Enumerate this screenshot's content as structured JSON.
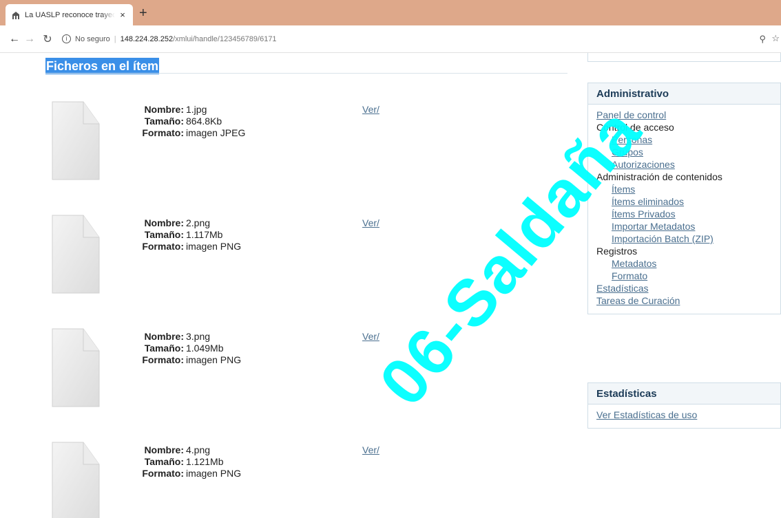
{
  "browser": {
    "tab_title": "La UASLP reconoce trayectoria a",
    "tab_close": "×",
    "new_tab": "+",
    "security_label": "No seguro",
    "url_host": "148.224.28.252",
    "url_path": "/xmlui/handle/123456789/6171"
  },
  "main": {
    "section_title": "Ficheros en el ítem",
    "labels": {
      "name": "Nombre:",
      "size": "Tamaño:",
      "format": "Formato:"
    },
    "view_label": "Ver/",
    "files": [
      {
        "name": "1.jpg",
        "size": "864.8Kb",
        "format": "imagen JPEG"
      },
      {
        "name": "2.png",
        "size": "1.117Mb",
        "format": "imagen PNG"
      },
      {
        "name": "3.png",
        "size": "1.049Mb",
        "format": "imagen PNG"
      },
      {
        "name": "4.png",
        "size": "1.121Mb",
        "format": "imagen PNG"
      }
    ]
  },
  "sidebar": {
    "admin": {
      "title": "Administrativo",
      "control_panel": "Panel de control",
      "access_control": "Control de acceso",
      "people": "Personas",
      "groups": "Grupos",
      "authorizations": "Autorizaciones",
      "content_admin": "Administración de contenidos",
      "items": "Ítems",
      "deleted_items": "Ítems eliminados",
      "private_items": "Ítems Privados",
      "import_metadata": "Importar Metadatos",
      "batch_import": "Importación Batch (ZIP)",
      "registries": "Registros",
      "metadata": "Metadatos",
      "format": "Formato",
      "statistics": "Estadísticas",
      "curation_tasks": "Tareas de Curación"
    },
    "stats": {
      "title": "Estadísticas",
      "view_usage": "Ver Estadísticas de uso"
    }
  },
  "watermark": "06-Saldaña"
}
